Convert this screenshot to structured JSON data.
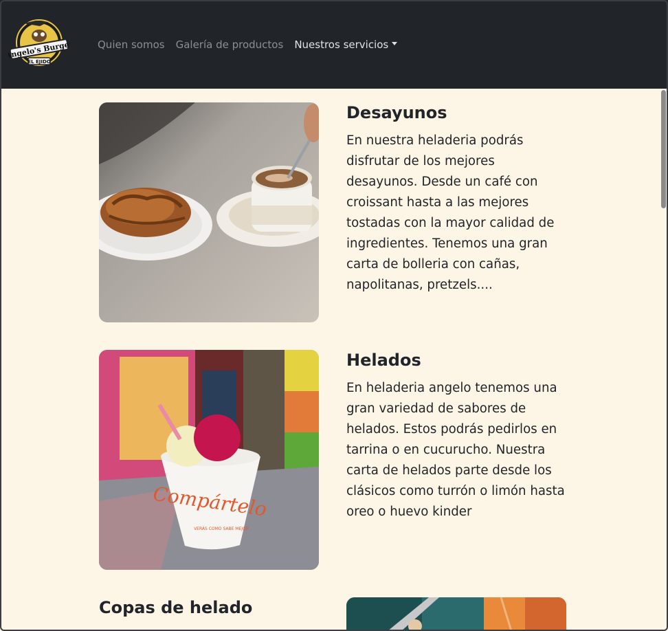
{
  "header": {
    "logo": {
      "text_top": "Angelo's Burger",
      "text_bottom": "EL EJIDO"
    },
    "nav": [
      {
        "label": "Quien somos"
      },
      {
        "label": "Galería de productos"
      },
      {
        "label": "Nuestros servicios"
      }
    ]
  },
  "sections": [
    {
      "title": "Desayunos",
      "text": "En nuestra heladeria podrás disfrutar de los mejores desayunos. Desde un café con croissant hasta a las mejores tostadas con la mayor calidad de ingredientes. Tenemos una gran carta de bolleria con cañas, napolitanas, pretzels...."
    },
    {
      "title": "Helados",
      "text": "En heladeria angelo tenemos una gran variedad de sabores de helados. Estos podrás pedirlos en tarrina o en cucurucho. Nuestra carta de helados parte desde los clásicos como turrón o limón hasta oreo o huevo kinder"
    },
    {
      "title": "Copas de helado"
    }
  ],
  "images": {
    "cup_text": "Compártelo",
    "cup_subtext": "VERÁS COMO SABE MEJOR"
  }
}
